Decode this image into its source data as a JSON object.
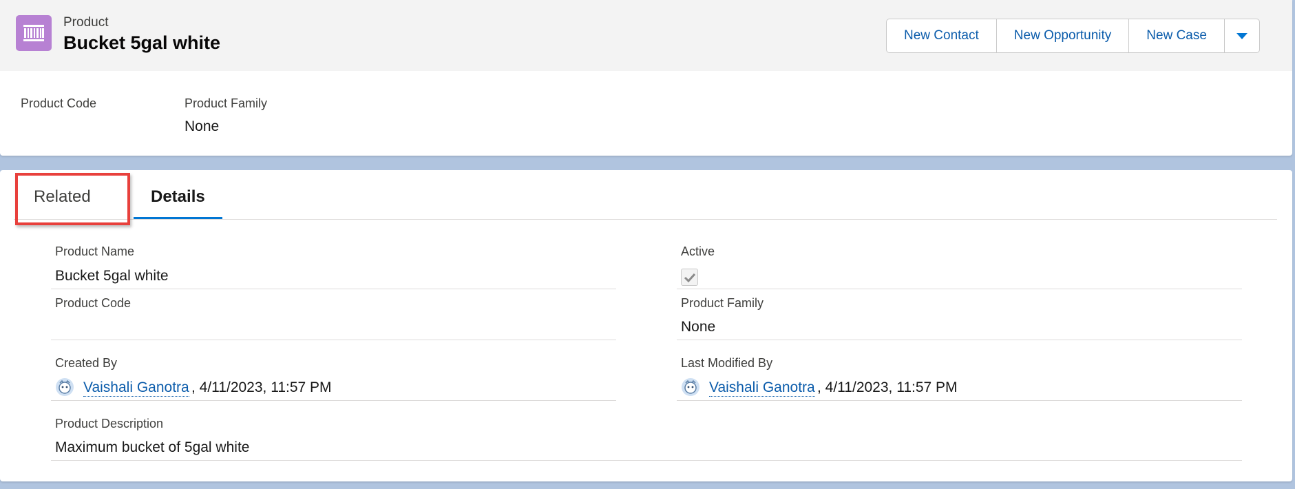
{
  "header": {
    "object_type": "Product",
    "title": "Bucket 5gal white",
    "icon": "product-icon",
    "icon_color": "#b781d3",
    "actions": [
      "New Contact",
      "New Opportunity",
      "New Case"
    ],
    "menu_icon": "chevron-down-icon"
  },
  "highlights": [
    {
      "label": "Product Code",
      "value": ""
    },
    {
      "label": "Product Family",
      "value": "None"
    }
  ],
  "tabs": [
    {
      "label": "Related",
      "active": false
    },
    {
      "label": "Details",
      "active": true
    }
  ],
  "fields": {
    "product_name": {
      "label": "Product Name",
      "value": "Bucket 5gal white"
    },
    "active": {
      "label": "Active",
      "checked": true
    },
    "product_code": {
      "label": "Product Code",
      "value": ""
    },
    "product_family": {
      "label": "Product Family",
      "value": "None"
    },
    "created_by": {
      "label": "Created By",
      "user": "Vaishali Ganotra",
      "date": ", 4/11/2023, 11:57 PM"
    },
    "last_modified_by": {
      "label": "Last Modified By",
      "user": "Vaishali Ganotra",
      "date": ", 4/11/2023, 11:57 PM"
    },
    "product_description": {
      "label": "Product Description",
      "value": "Maximum bucket of 5gal white"
    }
  },
  "colors": {
    "accent": "#0176d3",
    "link": "#0b5cab",
    "highlight_box": "#e8403c"
  }
}
